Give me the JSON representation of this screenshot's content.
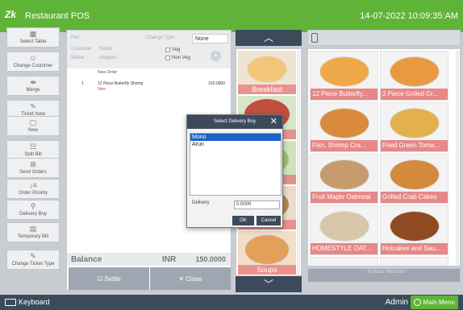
{
  "titlebar": {
    "brand": "Zk",
    "app_name": "Restaurant POS",
    "datetime": "14-07-2022 10:09:35:AM",
    "color": "#5fb437"
  },
  "sidebar": {
    "items": [
      {
        "label": "Select Table",
        "icon": "table-icon"
      },
      {
        "label": "Change Customer",
        "icon": "user-icon"
      },
      {
        "label": "Merge",
        "icon": "merge-icon"
      },
      {
        "label": "Ticket Note",
        "icon": "pencil-icon"
      },
      {
        "label": "New",
        "icon": "new-icon"
      },
      {
        "label": "Split Bill",
        "icon": "split-icon"
      },
      {
        "label": "Send Orders",
        "icon": "send-icon"
      },
      {
        "label": "Order Priority",
        "icon": "priority-icon"
      },
      {
        "label": "Delivery Boy",
        "icon": "delivery-icon"
      },
      {
        "label": "Temporary Bill",
        "icon": "bill-icon"
      },
      {
        "label": "Change Ticket Type",
        "icon": "ticket-icon"
      }
    ]
  },
  "order": {
    "header": {
      "pax_label": "Pax",
      "change_type_label": "Change Type",
      "change_type_value": "None",
      "customer_label": "Customer",
      "waiter_label": "Waiter",
      "retail_label": "Retail",
      "shipped_label": "shipped",
      "veg_label": "Veg",
      "non_veg_label": "Non Veg"
    },
    "new_order_label": "New Order",
    "items": [
      {
        "qty": "1",
        "name": "12 Piece Butterfly Shrimp",
        "price": "150.0000",
        "status": "New"
      }
    ],
    "balance_label": "Balance",
    "currency": "INR",
    "balance_value": "150.0000",
    "settle_label": "Settle",
    "close_label": "Close"
  },
  "categories": {
    "up_icon": "chevron-up-icon",
    "down_icon": "chevron-down-icon",
    "items": [
      {
        "label": "Breakfast"
      },
      {
        "label": ""
      },
      {
        "label": ""
      },
      {
        "label": ""
      },
      {
        "label": "Soups"
      }
    ]
  },
  "products": {
    "items": [
      {
        "label": "12 Piece Butterfly..."
      },
      {
        "label": "2 Piece Grilled Cr..."
      },
      {
        "label": "Fish, Shrimp  Cra..."
      },
      {
        "label": "Fried Green Toma..."
      },
      {
        "label": "Fruit Maple Oatmeal"
      },
      {
        "label": "Grilled Crab Cakes"
      },
      {
        "label": "HOMESTYLE OAT..."
      },
      {
        "label": "Hotcakes and Sau..."
      }
    ],
    "footer_button": "Invoice"
  },
  "watermark": "Activate Windows",
  "modal": {
    "title": "Select Delivery Boy",
    "options": [
      "Mono",
      "Arun"
    ],
    "selected": "Mono",
    "delivery_label": "Delivery",
    "delivery_value": "0.0000",
    "ok_label": "OK",
    "cancel_label": "Cancel"
  },
  "bottombar": {
    "keyboard_label": "Keyboard",
    "user_label": "Admin",
    "main_menu_label": "Main Menu"
  }
}
